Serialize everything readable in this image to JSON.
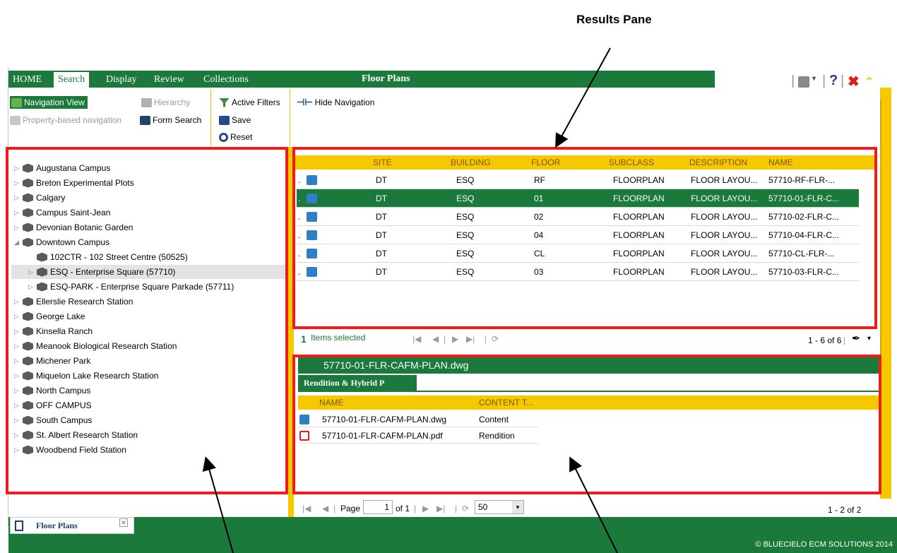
{
  "annotation": {
    "title": "Results Pane"
  },
  "menu": {
    "items": [
      "HOME",
      "Search",
      "Display",
      "Review",
      "Collections"
    ],
    "active": "Search",
    "app_title": "Floor Plans"
  },
  "toolbar": {
    "navigation_view": "Navigation View",
    "hierarchy": "Hierarchy",
    "property_nav": "Property-based navigation",
    "form_search": "Form Search",
    "active_filters": "Active Filters",
    "save": "Save",
    "reset": "Reset",
    "hide_navigation": "Hide Navigation"
  },
  "controls": {
    "help": "?",
    "close": "✖"
  },
  "tree": {
    "items": [
      {
        "label": "Augustana Campus",
        "level": 0,
        "expanded": false
      },
      {
        "label": "Breton Experimental Plots",
        "level": 0,
        "expanded": false
      },
      {
        "label": "Calgary",
        "level": 0,
        "expanded": false
      },
      {
        "label": "Campus Saint-Jean",
        "level": 0,
        "expanded": false
      },
      {
        "label": "Devonian Botanic Garden",
        "level": 0,
        "expanded": false
      },
      {
        "label": "Downtown Campus",
        "level": 0,
        "expanded": true
      },
      {
        "label": "102CTR - 102 Street Centre (50525)",
        "level": 1,
        "expanded": null
      },
      {
        "label": "ESQ - Enterprise Square (57710)",
        "level": 1,
        "expanded": false,
        "selected": true
      },
      {
        "label": "ESQ-PARK - Enterprise Square Parkade (57711)",
        "level": 1,
        "expanded": false
      },
      {
        "label": "Ellerslie Research Station",
        "level": 0,
        "expanded": false
      },
      {
        "label": "George Lake",
        "level": 0,
        "expanded": false
      },
      {
        "label": "Kinsella Ranch",
        "level": 0,
        "expanded": false
      },
      {
        "label": "Meanook Biological Research Station",
        "level": 0,
        "expanded": false
      },
      {
        "label": "Michener Park",
        "level": 0,
        "expanded": false
      },
      {
        "label": "Miquelon Lake Research Station",
        "level": 0,
        "expanded": false
      },
      {
        "label": "North Campus",
        "level": 0,
        "expanded": false
      },
      {
        "label": "OFF CAMPUS",
        "level": 0,
        "expanded": false
      },
      {
        "label": "South Campus",
        "level": 0,
        "expanded": false
      },
      {
        "label": "St. Albert Research Station",
        "level": 0,
        "expanded": false
      },
      {
        "label": "Woodbend Field Station",
        "level": 0,
        "expanded": false
      }
    ]
  },
  "results": {
    "columns": [
      "SITE",
      "BUILDING",
      "FLOOR",
      "SUBCLASS",
      "DESCRIPTION",
      "NAME"
    ],
    "rows": [
      {
        "site": "DT",
        "building": "ESQ",
        "floor": "RF",
        "subclass": "FLOORPLAN",
        "description": "FLOOR LAYOU...",
        "name": "57710-RF-FLR-...",
        "selected": false
      },
      {
        "site": "DT",
        "building": "ESQ",
        "floor": "01",
        "subclass": "FLOORPLAN",
        "description": "FLOOR LAYOU...",
        "name": "57710-01-FLR-C...",
        "selected": true
      },
      {
        "site": "DT",
        "building": "ESQ",
        "floor": "02",
        "subclass": "FLOORPLAN",
        "description": "FLOOR LAYOU...",
        "name": "57710-02-FLR-C...",
        "selected": false
      },
      {
        "site": "DT",
        "building": "ESQ",
        "floor": "04",
        "subclass": "FLOORPLAN",
        "description": "FLOOR LAYOU...",
        "name": "57710-04-FLR-C...",
        "selected": false
      },
      {
        "site": "DT",
        "building": "ESQ",
        "floor": "CL",
        "subclass": "FLOORPLAN",
        "description": "FLOOR LAYOU...",
        "name": "57710-CL-FLR-...",
        "selected": false
      },
      {
        "site": "DT",
        "building": "ESQ",
        "floor": "03",
        "subclass": "FLOORPLAN",
        "description": "FLOOR LAYOU...",
        "name": "57710-03-FLR-C...",
        "selected": false
      }
    ],
    "row_prefix": ".",
    "selected_count": "1",
    "selected_label": "Items selected",
    "range": "1 - 6 of 6"
  },
  "details": {
    "title": "57710-01-FLR-CAFM-PLAN.dwg",
    "tab": "Rendition & Hybrid P",
    "columns": [
      "NAME",
      "CONTENT T..."
    ],
    "rows": [
      {
        "name": "57710-01-FLR-CAFM-PLAN.dwg",
        "type": "Content",
        "icon": "dwg-icon"
      },
      {
        "name": "57710-01-FLR-CAFM-PLAN.pdf",
        "type": "Rendition",
        "icon": "pdf-icon"
      }
    ],
    "pager": {
      "page_label": "Page",
      "page": "1",
      "of": "of 1",
      "page_size": "50",
      "range": "1 - 2 of 2"
    }
  },
  "footer": {
    "tab": "Floor Plans",
    "copyright": "© BLUECIELO ECM SOLUTIONS 2014"
  },
  "colors": {
    "brand_green": "#1b7a3b",
    "accent_yellow": "#f5c800",
    "annotation_red": "#ee1c1c"
  }
}
